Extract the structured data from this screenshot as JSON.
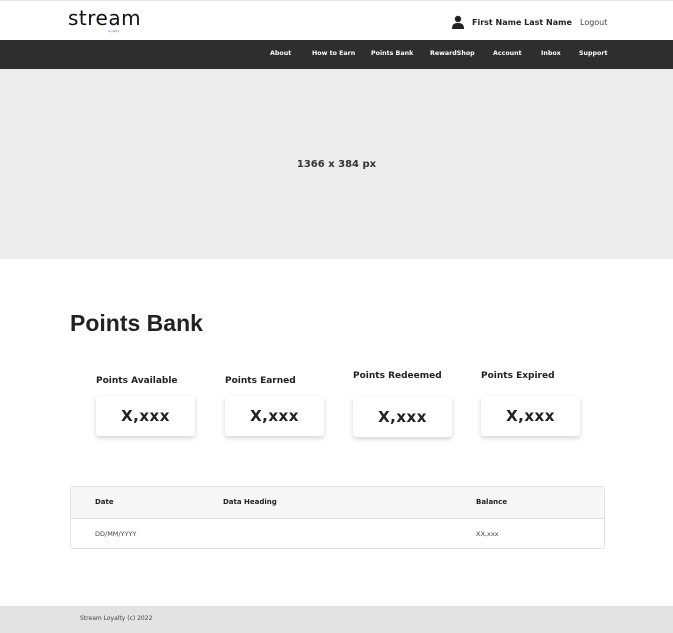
{
  "header": {
    "logo_text": "stream",
    "logo_subtext": "loyalty",
    "user_name": "First Name Last Name",
    "logout_label": "Logout"
  },
  "nav": {
    "items": [
      "About",
      "How to Earn",
      "Points Bank",
      "RewardShop",
      "Account",
      "Inbox",
      "Support"
    ]
  },
  "hero": {
    "placeholder_text": "1366 x 384 px"
  },
  "main": {
    "title": "Points Bank",
    "stats": [
      {
        "label": "Points Available",
        "value": "X,xxx"
      },
      {
        "label": "Points Earned",
        "value": "X,xxx"
      },
      {
        "label": "Points Redeemed",
        "value": "X,xxx"
      },
      {
        "label": "Points Expired",
        "value": "X,xxx"
      }
    ],
    "table": {
      "headers": [
        "Date",
        "Data Heading",
        "Balance"
      ],
      "rows": [
        [
          "DD/MM/YYYY",
          "",
          "XX,xxx"
        ]
      ]
    }
  },
  "footer": {
    "text": "Stream Loyalty (c) 2022"
  },
  "colors": {
    "nav_bg": "#2e2e2e",
    "hero_bg": "#ececec",
    "footer_bg": "#e3e3e3",
    "logo_accent": "#6a3fd6"
  }
}
